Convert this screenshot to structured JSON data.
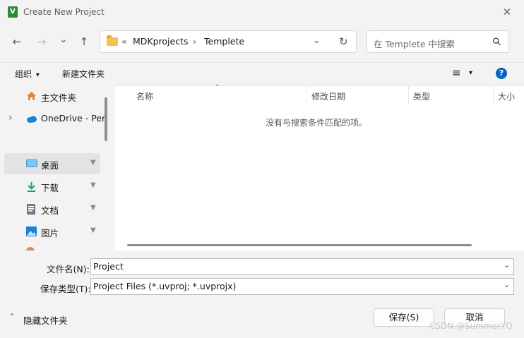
{
  "window": {
    "title": "Create New Project",
    "app_icon_glyph": "V"
  },
  "nav": {
    "back": "←",
    "forward": "→",
    "recent": "⌄",
    "up": "↑",
    "breadcrumb_prefix": "«",
    "breadcrumbs": [
      "MDKprojects",
      "Templete"
    ],
    "crumb_sep": "›",
    "dropdown": "⌄",
    "refresh": "↻"
  },
  "search": {
    "placeholder": "在 Templete 中搜索",
    "icon": "⚲"
  },
  "toolbar": {
    "organize_label": "组织",
    "organize_caret": "▾",
    "new_folder_label": "新建文件夹",
    "view_icon": "≡",
    "view_caret": "▾",
    "help": "?"
  },
  "sidebar": {
    "items": [
      {
        "label": "主文件夹",
        "icon": "home-icon",
        "pinned": false
      },
      {
        "label": "OneDrive - Per",
        "icon": "cloud-icon",
        "pinned": false,
        "expandable": true
      },
      {
        "label": "桌面",
        "icon": "desktop-icon",
        "pinned": true,
        "selected": true
      },
      {
        "label": "下载",
        "icon": "download-icon",
        "pinned": true
      },
      {
        "label": "文档",
        "icon": "document-icon",
        "pinned": true
      },
      {
        "label": "图片",
        "icon": "picture-icon",
        "pinned": true
      }
    ],
    "pin_glyph": "📌",
    "expand_glyph": "›"
  },
  "list": {
    "columns": [
      "名称",
      "修改日期",
      "类型",
      "大小"
    ],
    "sort_glyph": "˄",
    "empty_message": "没有与搜索条件匹配的项。"
  },
  "form": {
    "filename_label": "文件名(N):",
    "filename_value": "Project",
    "filetype_label": "保存类型(T):",
    "filetype_value": "Project Files (*.uvproj; *.uvprojx)",
    "dropdown_glyph": "⌄"
  },
  "footer": {
    "hide_folders_label": "隐藏文件夹",
    "hide_caret": "˄",
    "save_label": "保存(S)",
    "cancel_label": "取消",
    "watermark": "CSDN @SummerYQ"
  },
  "colors": {
    "accent": "#0067c0",
    "folder": "#f3c24c",
    "selected": "#e3e3e3"
  }
}
